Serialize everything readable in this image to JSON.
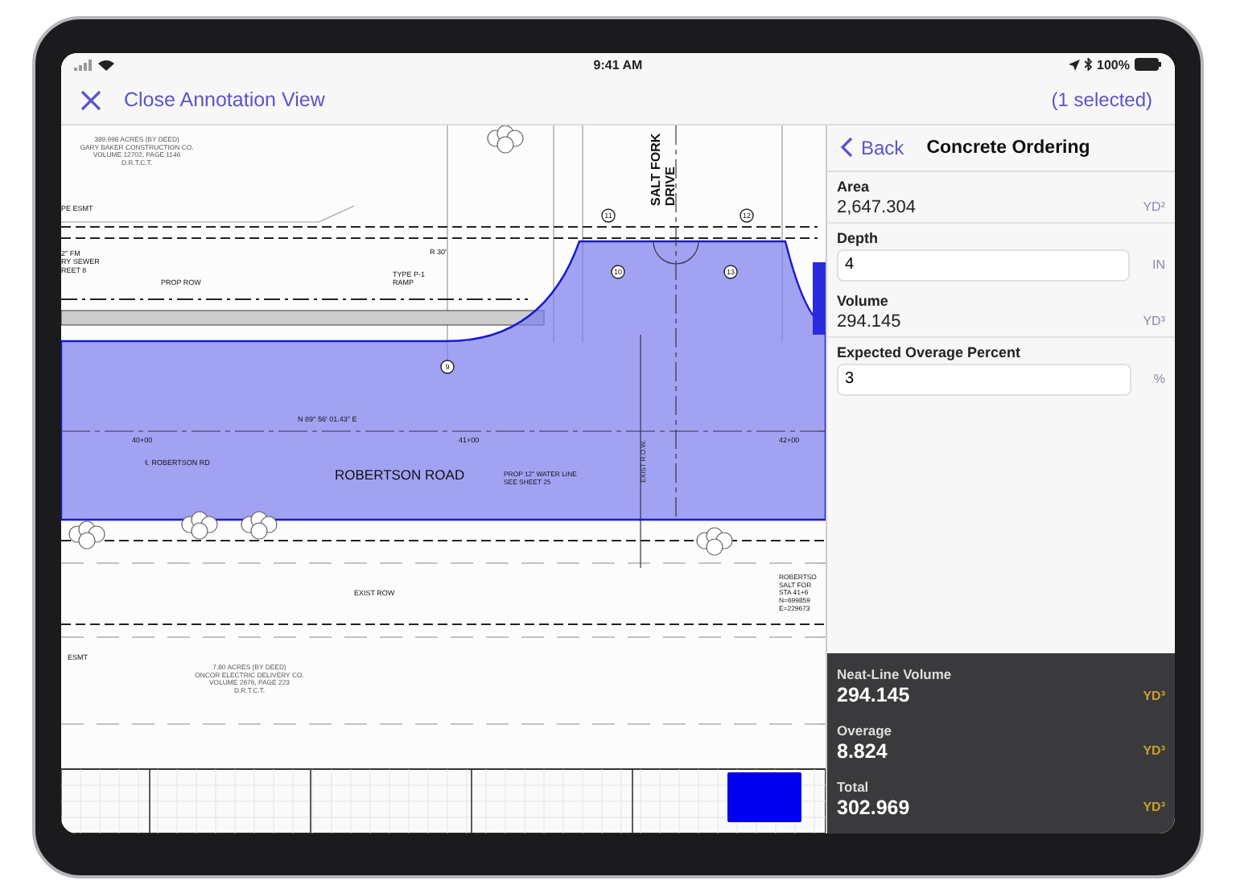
{
  "status_bar": {
    "time": "9:41 AM",
    "battery": "100%"
  },
  "nav_bar": {
    "close_label": "Close Annotation View",
    "selection": "(1 selected)"
  },
  "plan": {
    "labels": [
      {
        "kind": "note",
        "lines": [
          "389.998 ACRES (BY DEED)",
          "GARY BAKER CONSTRUCTION CO.",
          "VOLUME 12702, PAGE 1146",
          "D.R.T.C.T."
        ]
      },
      {
        "kind": "label",
        "lines": [
          "PE ESMT"
        ]
      },
      {
        "kind": "label",
        "lines": [
          "2\" FM",
          "RY SEWER",
          "REET 8"
        ]
      },
      {
        "kind": "label",
        "lines": [
          "PROP ROW"
        ]
      },
      {
        "kind": "label",
        "lines": [
          "R 30'"
        ]
      },
      {
        "kind": "label",
        "lines": [
          "TYPE P-1",
          "RAMP"
        ]
      },
      {
        "kind": "street",
        "lines": [
          "SALT FORK",
          "DRIVE"
        ]
      },
      {
        "kind": "label",
        "lines": [
          "N 89° 56' 01.43\" E"
        ]
      },
      {
        "kind": "label",
        "lines": [
          "40+00"
        ]
      },
      {
        "kind": "label",
        "lines": [
          "41+00"
        ]
      },
      {
        "kind": "label",
        "lines": [
          "42+00"
        ]
      },
      {
        "kind": "label",
        "lines": [
          "℄ ROBERTSON RD"
        ]
      },
      {
        "kind": "road",
        "lines": [
          "ROBERTSON ROAD"
        ]
      },
      {
        "kind": "label",
        "lines": [
          "PROP 12\" WATER LINE",
          "SEE SHEET 25"
        ]
      },
      {
        "kind": "vertical",
        "lines": [
          "EXIST R.O.W."
        ]
      },
      {
        "kind": "label",
        "lines": [
          "EXIST ROW"
        ]
      },
      {
        "kind": "label",
        "lines": [
          "ESMT"
        ]
      },
      {
        "kind": "note",
        "lines": [
          "7.80 ACRES (BY DEED)",
          "ONCOR ELECTRIC DELIVERY CO.",
          "VOLUME 2676, PAGE 223",
          "D.R.T.C.T."
        ]
      },
      {
        "kind": "label",
        "lines": [
          "ROBERTSO",
          "SALT FOR",
          "STA 41+6",
          "N=699859",
          "E=229673"
        ]
      }
    ],
    "callouts": [
      "11",
      "10",
      "13",
      "12",
      "9"
    ]
  },
  "panel": {
    "back": "Back",
    "title": "Concrete Ordering",
    "fields": [
      {
        "kind": "readout",
        "label": "Area",
        "value": "2,647.304",
        "unit": "YD²"
      },
      {
        "kind": "input",
        "label": "Depth",
        "value": "4",
        "unit": "IN"
      },
      {
        "kind": "readout",
        "label": "Volume",
        "value": "294.145",
        "unit": "YD³"
      },
      {
        "kind": "input",
        "label": "Expected Overage Percent",
        "value": "3",
        "unit": "%"
      }
    ],
    "summary": [
      {
        "label": "Neat-Line Volume",
        "value": "294.145",
        "unit": "YD³"
      },
      {
        "label": "Overage",
        "value": "8.824",
        "unit": "YD³"
      },
      {
        "label": "Total",
        "value": "302.969",
        "unit": "YD³"
      }
    ]
  }
}
